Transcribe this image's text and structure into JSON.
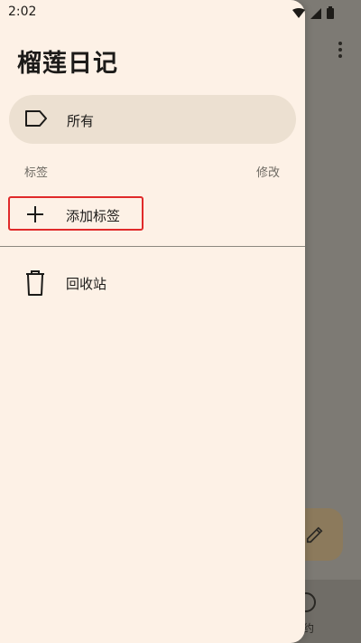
{
  "status_bar": {
    "time": "2:02"
  },
  "drawer": {
    "app_title": "榴莲日记",
    "nav_all_label": "所有",
    "labels_header": "标签",
    "edit_label": "修改",
    "add_label": "添加标签",
    "trash_label": "回收站"
  },
  "background": {
    "bottom_label_partial": "约"
  },
  "colors": {
    "drawer_bg": "#fdf1e6",
    "selected_item_bg": "#ece0d1",
    "highlight_border": "#e02a2a",
    "fab_bg": "#8c7a5c"
  },
  "icons": {
    "nav_all": "label-tag-icon",
    "add_label": "plus-icon",
    "trash": "trash-can-icon",
    "fab": "pencil-icon",
    "overflow": "more-vert-icon"
  }
}
